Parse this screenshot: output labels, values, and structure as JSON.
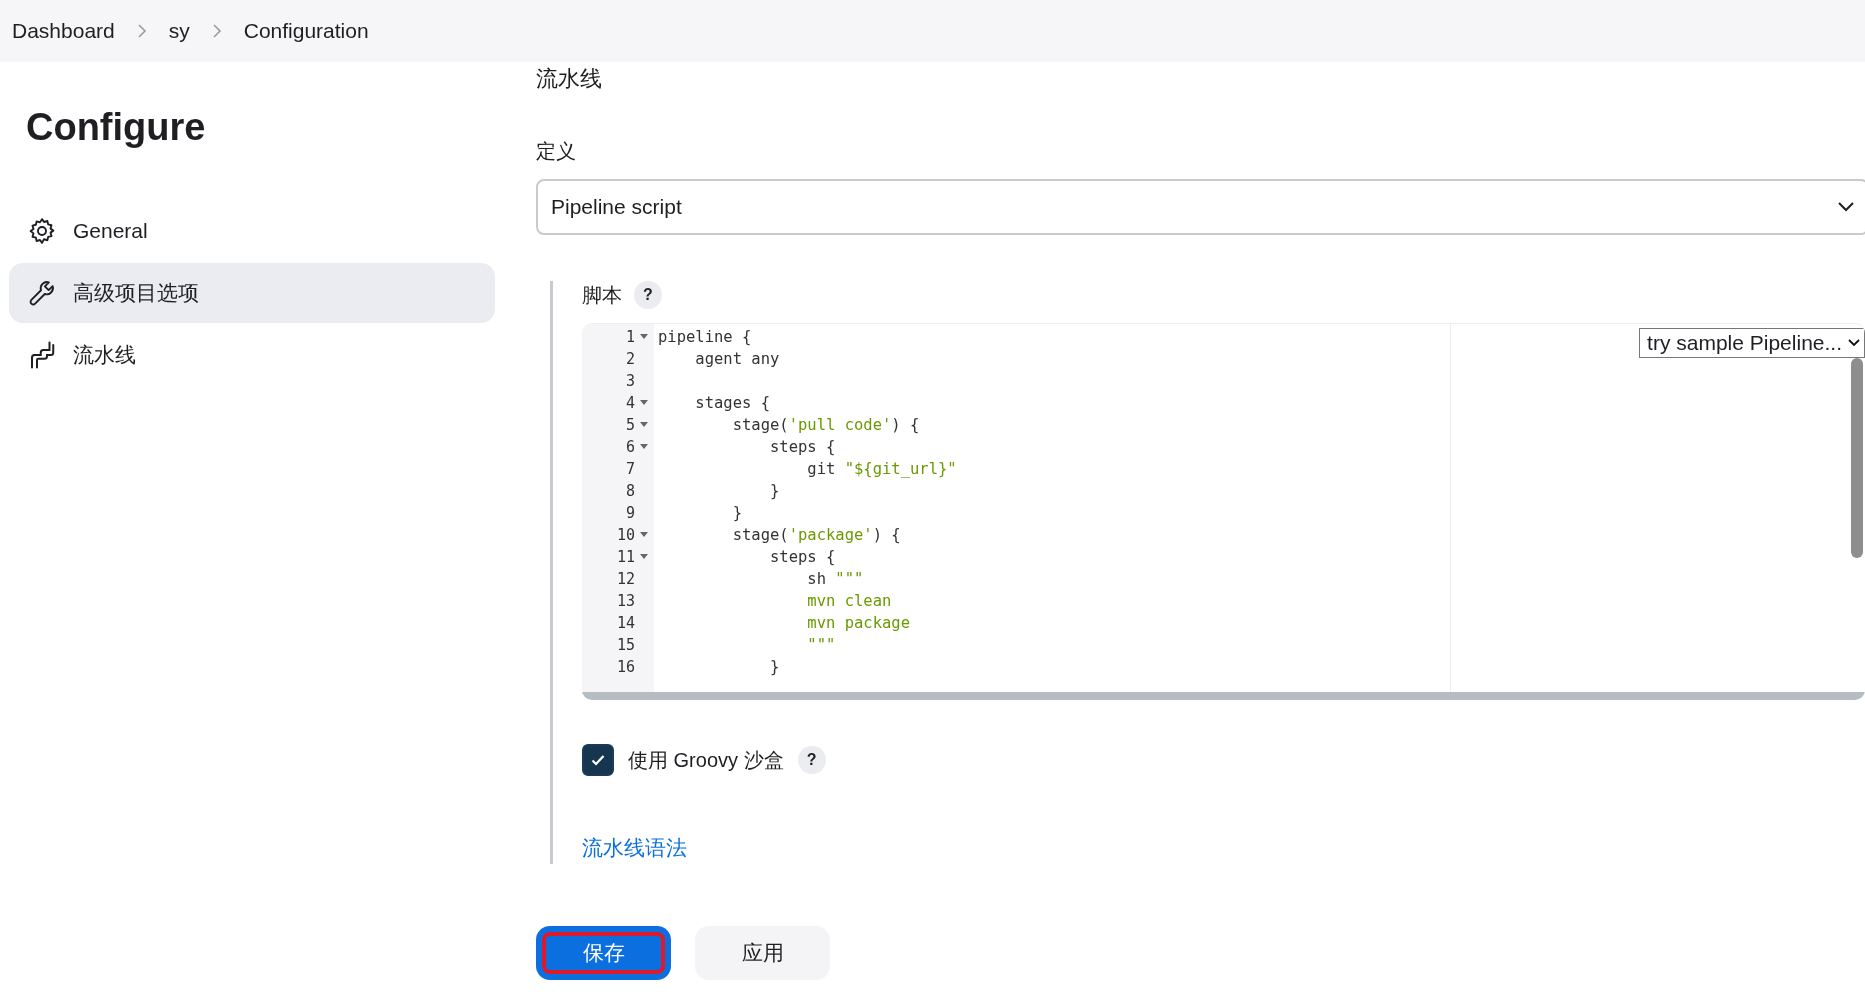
{
  "breadcrumbs": [
    {
      "label": "Dashboard"
    },
    {
      "label": "sy"
    },
    {
      "label": "Configuration"
    }
  ],
  "sidebar": {
    "title": "Configure",
    "items": [
      {
        "label": "General",
        "selected": false
      },
      {
        "label": "高级项目选项",
        "selected": true
      },
      {
        "label": "流水线",
        "selected": false
      }
    ]
  },
  "section_title": "流水线",
  "definition": {
    "label": "定义",
    "value": "Pipeline script"
  },
  "script": {
    "label": "脚本",
    "help": "?",
    "sample_select": "try sample Pipeline...",
    "lines": [
      {
        "number": "1",
        "fold": true,
        "segments": [
          {
            "text": "pipeline {",
            "kind": "plain"
          }
        ]
      },
      {
        "number": "2",
        "fold": false,
        "segments": [
          {
            "text": "    agent any",
            "kind": "plain"
          }
        ]
      },
      {
        "number": "3",
        "fold": false
      },
      {
        "number": "4",
        "fold": true,
        "segments": [
          {
            "text": "    stages {",
            "kind": "plain"
          }
        ]
      },
      {
        "number": "5",
        "fold": true,
        "segments": [
          {
            "text": "        stage(",
            "kind": "plain"
          },
          {
            "text": "'pull code'",
            "kind": "string"
          },
          {
            "text": ") {",
            "kind": "plain"
          }
        ]
      },
      {
        "number": "6",
        "fold": true,
        "segments": [
          {
            "text": "            steps {",
            "kind": "plain"
          }
        ]
      },
      {
        "number": "7",
        "fold": false,
        "segments": [
          {
            "text": "                git ",
            "kind": "plain"
          },
          {
            "text": "\"${git_url}\"",
            "kind": "string"
          }
        ]
      },
      {
        "number": "8",
        "fold": false,
        "segments": [
          {
            "text": "            }",
            "kind": "plain"
          }
        ]
      },
      {
        "number": "9",
        "fold": false,
        "segments": [
          {
            "text": "        }",
            "kind": "plain"
          }
        ]
      },
      {
        "number": "10",
        "fold": true,
        "segments": [
          {
            "text": "        stage(",
            "kind": "plain"
          },
          {
            "text": "'package'",
            "kind": "string"
          },
          {
            "text": ") {",
            "kind": "plain"
          }
        ]
      },
      {
        "number": "11",
        "fold": true,
        "segments": [
          {
            "text": "            steps {",
            "kind": "plain"
          }
        ]
      },
      {
        "number": "12",
        "fold": false,
        "segments": [
          {
            "text": "                sh ",
            "kind": "plain"
          },
          {
            "text": "\"\"\"",
            "kind": "string"
          }
        ]
      },
      {
        "number": "13",
        "fold": false,
        "segments": [
          {
            "text": "                mvn clean",
            "kind": "string"
          }
        ]
      },
      {
        "number": "14",
        "fold": false,
        "segments": [
          {
            "text": "                mvn package",
            "kind": "string"
          }
        ]
      },
      {
        "number": "15",
        "fold": false,
        "segments": [
          {
            "text": "                \"\"\"",
            "kind": "string"
          }
        ]
      },
      {
        "number": "16",
        "fold": false,
        "segments": [
          {
            "text": "            }",
            "kind": "plain"
          }
        ]
      }
    ]
  },
  "sandbox": {
    "label": "使用 Groovy 沙盒",
    "checked": true,
    "help": "?"
  },
  "syntax_link": "流水线语法",
  "buttons": [
    {
      "label": "保存",
      "kind": "primary",
      "highlighted": true
    },
    {
      "label": "应用",
      "kind": "secondary",
      "highlighted": false
    }
  ]
}
